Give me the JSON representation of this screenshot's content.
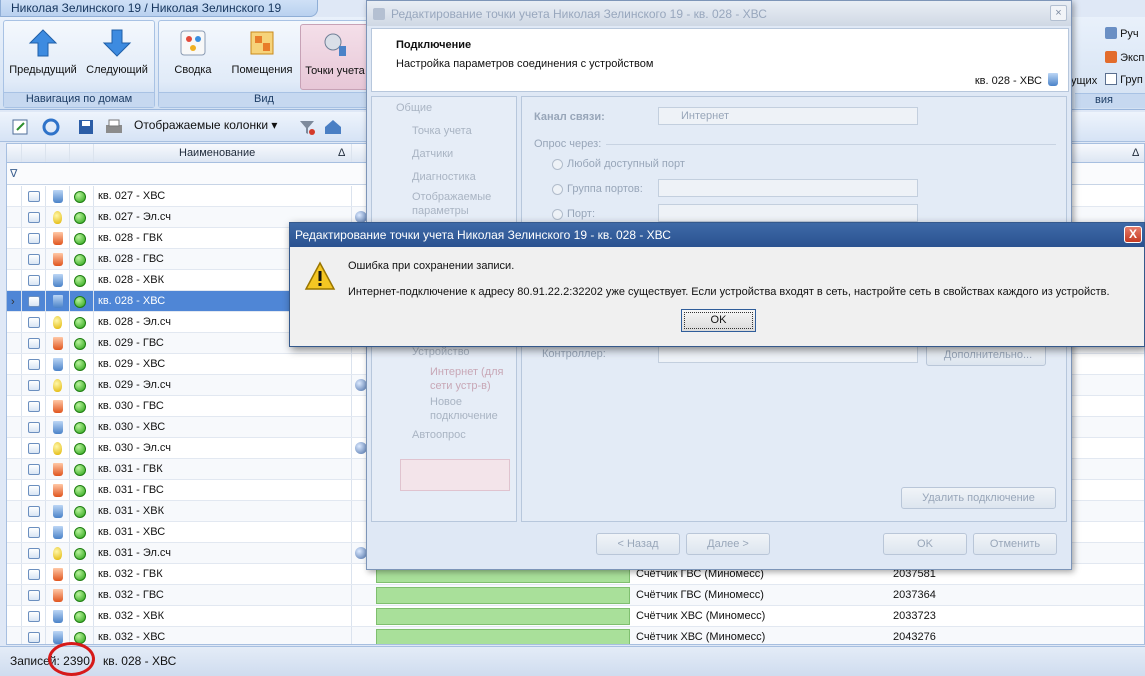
{
  "window": {
    "tab_title": "Николая Зелинского 19 / Николая Зелинского 19"
  },
  "ribbon": {
    "groups": {
      "nav": "Навигация по домам",
      "view": "Вид",
      "right": "вия"
    },
    "buttons": {
      "prev": "Предыдущий",
      "next": "Следующий",
      "summary": "Сводка",
      "rooms": "Помещения",
      "points": "Точки учета"
    },
    "right_items": {
      "manual": "Руч",
      "export": "Эксп",
      "group": "Груп",
      "partial": "ущих"
    }
  },
  "toolbar": {
    "columns_label": "Отображаемые колонки"
  },
  "grid": {
    "header_name": "Наименование",
    "sort_glyph": "Δ",
    "filter_glyph": "∇",
    "rows": [
      {
        "name": "кв. 027 - ХВС",
        "type": "hvs",
        "globe": false
      },
      {
        "name": "кв. 027 - Эл.сч",
        "type": "el",
        "globe": true
      },
      {
        "name": "кв. 028 - ГВК",
        "type": "gvs",
        "globe": false
      },
      {
        "name": "кв. 028 - ГВС",
        "type": "gvs",
        "globe": false
      },
      {
        "name": "кв. 028 - ХВК",
        "type": "hvs",
        "globe": false
      },
      {
        "name": "кв. 028 - ХВС",
        "type": "hvs",
        "globe": false,
        "selected": true
      },
      {
        "name": "кв. 028 - Эл.сч",
        "type": "el",
        "globe": false
      },
      {
        "name": "кв. 029 - ГВС",
        "type": "gvs",
        "globe": false
      },
      {
        "name": "кв. 029 - ХВС",
        "type": "hvs",
        "globe": false
      },
      {
        "name": "кв. 029 - Эл.сч",
        "type": "el",
        "globe": true
      },
      {
        "name": "кв. 030 - ГВС",
        "type": "gvs",
        "globe": false
      },
      {
        "name": "кв. 030 - ХВС",
        "type": "hvs",
        "globe": false
      },
      {
        "name": "кв. 030 - Эл.сч",
        "type": "el",
        "globe": true
      },
      {
        "name": "кв. 031 - ГВК",
        "type": "gvs",
        "globe": false
      },
      {
        "name": "кв. 031 - ГВС",
        "type": "gvs",
        "globe": false
      },
      {
        "name": "кв. 031 - ХВК",
        "type": "hvs",
        "globe": false
      },
      {
        "name": "кв. 031 - ХВС",
        "type": "hvs",
        "globe": false
      },
      {
        "name": "кв. 031 - Эл.сч",
        "type": "el",
        "globe": true
      },
      {
        "name": "кв. 032 - ГВК",
        "type": "gvs",
        "globe": false,
        "ctype": "Счётчик ГВС (Миномесс)",
        "serial": "2037581"
      },
      {
        "name": "кв. 032 - ГВС",
        "type": "gvs",
        "globe": false,
        "ctype": "Счётчик ГВС (Миномесс)",
        "serial": "2037364"
      },
      {
        "name": "кв. 032 - ХВК",
        "type": "hvs",
        "globe": false,
        "ctype": "Счётчик ХВС (Миномесс)",
        "serial": "2033723"
      },
      {
        "name": "кв. 032 - ХВС",
        "type": "hvs",
        "globe": false,
        "ctype": "Счётчик ХВС (Миномесс)",
        "serial": "2043276"
      }
    ]
  },
  "status": {
    "records_label": "Записей: 2390",
    "current": "кв. 028 - ХВС"
  },
  "edit_dialog": {
    "title": "Редактирование точки учета Николая Зелинского 19 - кв. 028 - ХВС",
    "close": "×",
    "header_title": "Подключение",
    "header_subtitle": "Настройка параметров соединения с устройством",
    "header_point": "кв. 028 - ХВС",
    "nav": {
      "general": "Общие",
      "point": "Точка учета",
      "sensors": "Датчики",
      "diag": "Диагностика",
      "display1": "Отображаемые",
      "display2": "параметры",
      "device": "Устройство",
      "inet1": "Интернет (для",
      "inet2": "сети устр-в)",
      "newconn1": "Новое",
      "newconn2": "подключение",
      "autopoll": "Автоопрос"
    },
    "body": {
      "channel_label": "Канал связи:",
      "channel_value": "Интернет",
      "poll_via": "Опрос через:",
      "any_port": "Любой доступный порт",
      "port_group": "Группа портов:",
      "port": "Порт:",
      "controller": "Контроллер:",
      "more": "Дополнительно...",
      "delete_conn": "Удалить подключение"
    },
    "buttons": {
      "back": "< Назад",
      "next": "Далее >",
      "ok": "OK",
      "cancel": "Отменить"
    }
  },
  "error_dialog": {
    "title": "Редактирование точки учета Николая Зелинского 19 - кв. 028 - ХВС",
    "close": "X",
    "line1": "Ошибка при сохранении записи.",
    "line2": "Интернет-подключение к адресу 80.91.22.2:32202 уже существует. Если устройства входят в сеть, настройте сеть в свойствах каждого из устройств.",
    "ok": "OK"
  }
}
